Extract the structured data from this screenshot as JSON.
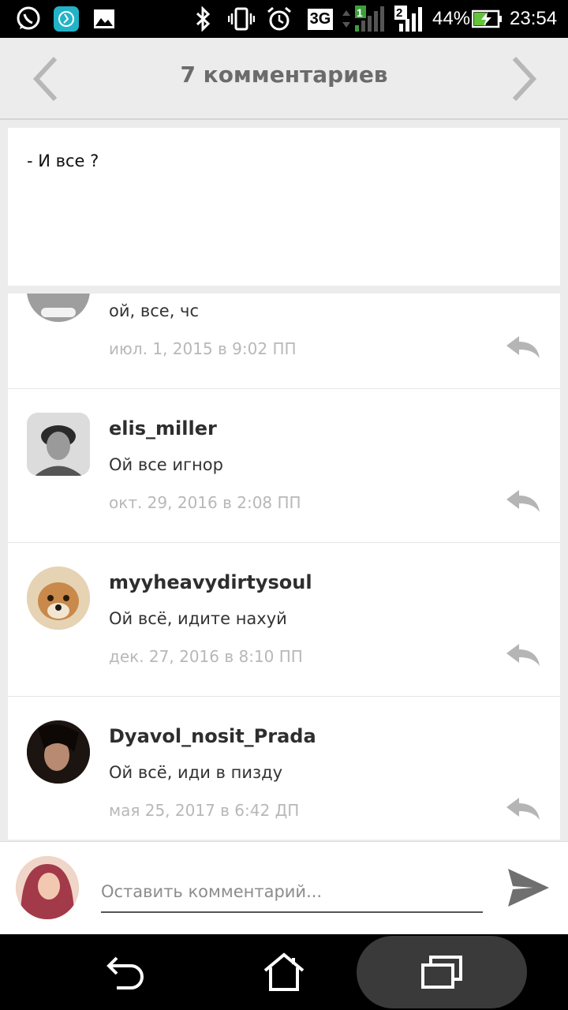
{
  "status_bar": {
    "network": "3G",
    "sim1": "1",
    "sim2": "2",
    "battery": "44%",
    "time": "23:54",
    "icons": [
      "whatsapp-icon",
      "fitness-app-icon",
      "gallery-icon",
      "bluetooth-icon",
      "vibrate-icon",
      "alarm-icon",
      "signal-icon",
      "battery-icon"
    ]
  },
  "header": {
    "title": "7 комментариев",
    "prev_icon": "chevron-left-icon",
    "next_icon": "chevron-right-icon"
  },
  "post": {
    "text": "- И все ?"
  },
  "comments": [
    {
      "user": "",
      "text": "ой, все, чс",
      "date": "июл. 1, 2015 в 9:02 ПП"
    },
    {
      "user": "elis_miller",
      "text": "Ой все игнор",
      "date": "окт. 29, 2016 в 2:08 ПП"
    },
    {
      "user": "myyheavydirtysoul",
      "text": "Ой всё, идите нахуй",
      "date": "дек. 27, 2016 в 8:10 ПП"
    },
    {
      "user": "Dyavol_nosit_Prada",
      "text": "Ой всё, иди в пизду",
      "date": "мая 25, 2017 в 6:42 ДП"
    }
  ],
  "compose": {
    "placeholder": "Оставить комментарий..."
  },
  "colors": {
    "accent": "#6b6b6b",
    "date_gray": "#b8b8b8",
    "background": "#ececec"
  }
}
